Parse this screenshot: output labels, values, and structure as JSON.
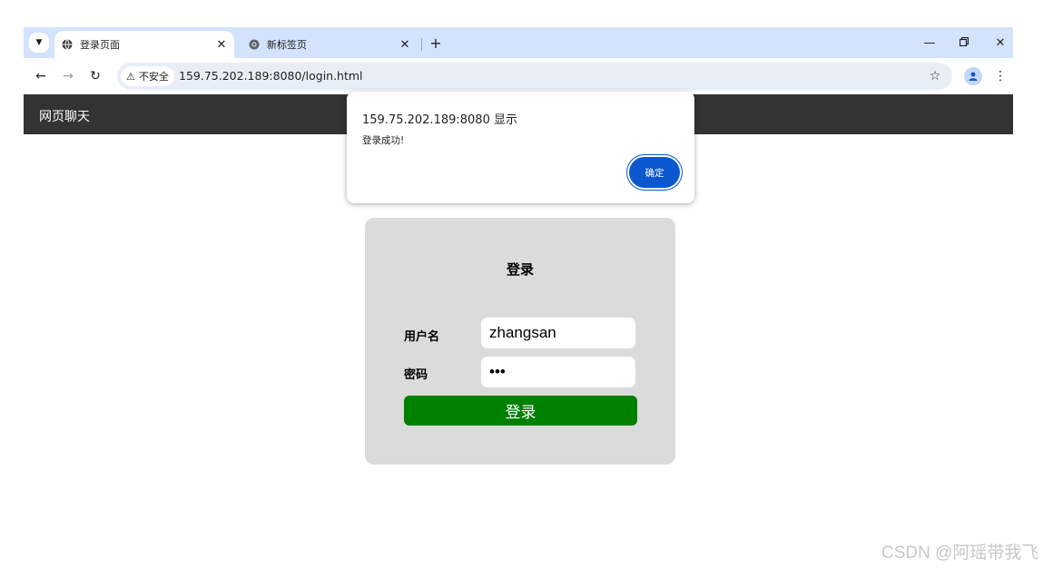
{
  "browser": {
    "tabs": [
      {
        "title": "登录页面",
        "active": true
      },
      {
        "title": "新标签页",
        "active": false
      }
    ],
    "security_label": "不安全",
    "url": "159.75.202.189:8080/login.html"
  },
  "page": {
    "navbar_title": "网页聊天",
    "login": {
      "heading": "登录",
      "username_label": "用户名",
      "username_value": "zhangsan",
      "password_label": "密码",
      "password_value": "•••",
      "submit_label": "登录"
    }
  },
  "alert": {
    "origin": "159.75.202.189:8080 显示",
    "message": "登录成功!",
    "ok_label": "确定"
  },
  "watermark": "CSDN @阿瑶带我飞",
  "colors": {
    "tabstrip": "#d3e3fd",
    "navbar": "#333333",
    "card": "#dbdbdb",
    "login_button": "#008000",
    "dialog_button": "#0b57d0"
  },
  "icons": {
    "tab_favicon": "globe-icon",
    "new_tab_favicon": "chrome-icon",
    "security": "warning-icon",
    "bookmark": "star-icon",
    "profile": "person-icon"
  }
}
